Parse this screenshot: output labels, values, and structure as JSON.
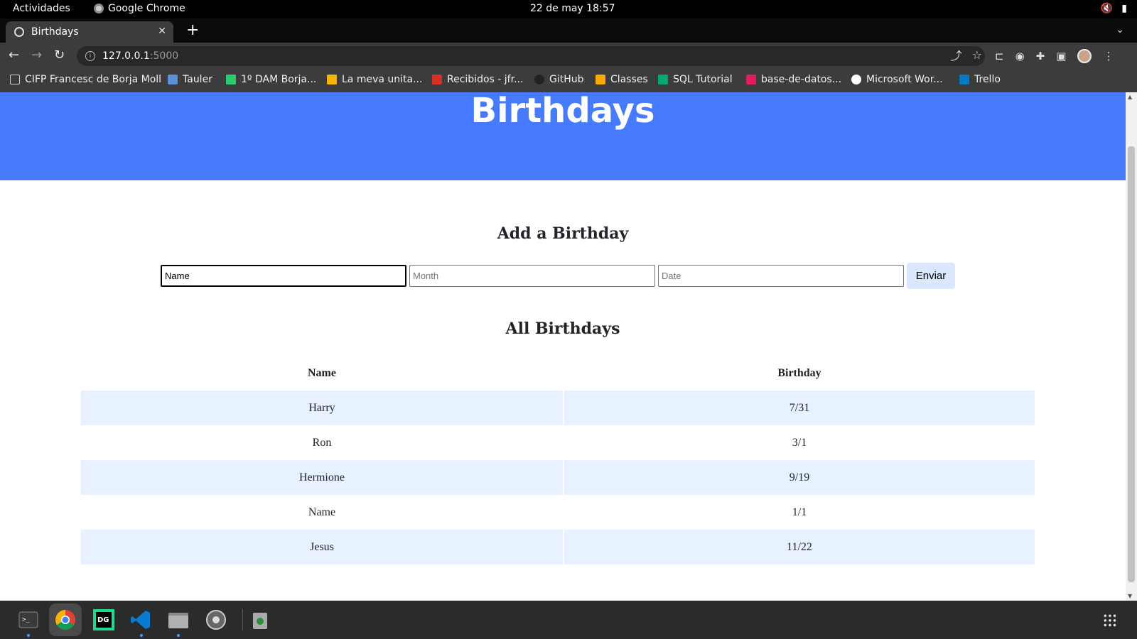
{
  "system_bar": {
    "activities": "Actividades",
    "app_name": "Google Chrome",
    "clock": "22 de may  18:57"
  },
  "browser": {
    "tab_title": "Birthdays",
    "url_host": "127.0.0.1",
    "url_port": ":5000",
    "bookmarks": [
      "CIFP Francesc de Borja Moll",
      "Tauler",
      "1º DAM Borja...",
      "La meva unita...",
      "Recibidos - jfr...",
      "GitHub",
      "Classes",
      "SQL Tutorial",
      "base-de-datos...",
      "Microsoft Wor...",
      "Trello"
    ]
  },
  "page": {
    "header_title": "Birthdays",
    "add_section_title": "Add a Birthday",
    "form": {
      "name_value": "Name",
      "name_placeholder": "Name",
      "month_placeholder": "Month",
      "date_placeholder": "Date",
      "submit_label": "Enviar"
    },
    "all_section_title": "All Birthdays",
    "table": {
      "headers": [
        "Name",
        "Birthday"
      ],
      "rows": [
        [
          "Harry",
          "7/31"
        ],
        [
          "Ron",
          "3/1"
        ],
        [
          "Hermione",
          "9/19"
        ],
        [
          "Name",
          "1/1"
        ],
        [
          "Jesus",
          "11/22"
        ]
      ]
    }
  },
  "colors": {
    "header_bg": "#477bff",
    "row_stripe": "#e8f1ff",
    "button_bg": "#dbe7ff"
  },
  "dock": {
    "items": [
      "terminal-icon",
      "chrome-icon",
      "datagrip-icon",
      "vscode-icon",
      "files-icon",
      "settings-icon",
      "trash-icon"
    ]
  }
}
